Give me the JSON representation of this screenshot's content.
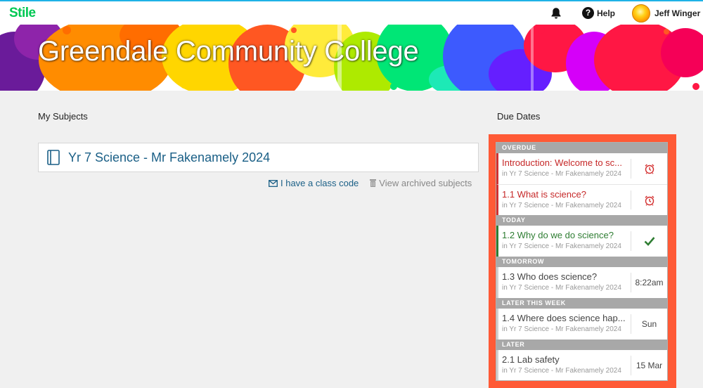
{
  "app": {
    "logo": "Stile",
    "accent": "#00c853",
    "topline_color": "#1fb2e6"
  },
  "header": {
    "bell_icon": "bell-icon",
    "help_label": "Help",
    "help_icon": "question-circle-icon",
    "user_name": "Jeff Winger"
  },
  "banner": {
    "title": "Greendale Community College"
  },
  "subjects": {
    "heading": "My Subjects",
    "items": [
      {
        "name": "Yr 7 Science - Mr Fakenamely 2024",
        "icon": "book-icon"
      }
    ],
    "class_code_label": "I have a class code",
    "class_code_icon": "envelope-icon",
    "archived_label": "View archived subjects",
    "archived_icon": "trash-icon"
  },
  "due": {
    "heading": "Due Dates",
    "frame_color": "#ff5a36",
    "groups": [
      {
        "label": "OVERDUE",
        "items": [
          {
            "title": "Introduction: Welcome to sc...",
            "subject": "in Yr 7 Science - Mr Fakenamely 2024",
            "status": "overdue",
            "side_icon": "alarm-clock-icon"
          },
          {
            "title": "1.1 What is science?",
            "subject": "in Yr 7 Science - Mr Fakenamely 2024",
            "status": "overdue",
            "side_icon": "alarm-clock-icon"
          }
        ]
      },
      {
        "label": "TODAY",
        "items": [
          {
            "title": "1.2 Why do we do science?",
            "subject": "in Yr 7 Science - Mr Fakenamely 2024",
            "status": "today",
            "side_icon": "checkmark-icon"
          }
        ]
      },
      {
        "label": "TOMORROW",
        "items": [
          {
            "title": "1.3 Who does science?",
            "subject": "in Yr 7 Science - Mr Fakenamely 2024",
            "status": "plain",
            "side_text": "8:22am"
          }
        ]
      },
      {
        "label": "LATER THIS WEEK",
        "items": [
          {
            "title": "1.4 Where does science hap...",
            "subject": "in Yr 7 Science - Mr Fakenamely 2024",
            "status": "plain",
            "side_text": "Sun"
          }
        ]
      },
      {
        "label": "LATER",
        "items": [
          {
            "title": "2.1 Lab safety",
            "subject": "in Yr 7 Science - Mr Fakenamely 2024",
            "status": "plain",
            "side_text": "15 Mar"
          }
        ]
      }
    ]
  }
}
